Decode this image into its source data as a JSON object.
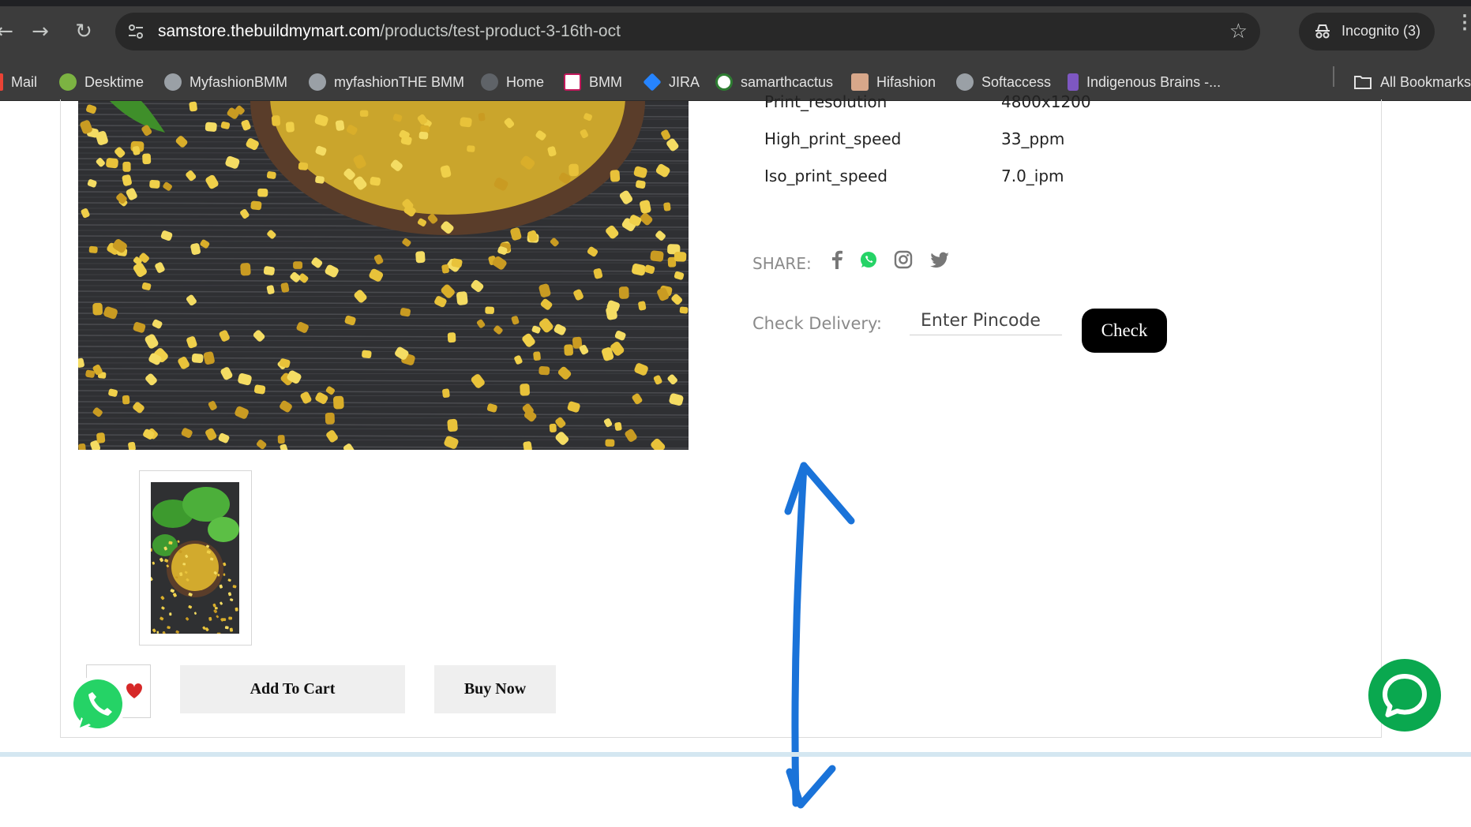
{
  "browser": {
    "url_host": "samstore.thebuildmymart.com",
    "url_path": "/products/test-product-3-16th-oct",
    "incognito_label": "Incognito (3)",
    "nav_icons": [
      "back-arrow-icon",
      "forward-arrow-icon",
      "reload-icon"
    ],
    "bookmarks": [
      {
        "label": "Mail",
        "color": "#ea4335"
      },
      {
        "label": "Desktime",
        "color": "#7cb342"
      },
      {
        "label": "MyfashionBMM",
        "color": "#9aa0a6"
      },
      {
        "label": "myfashionTHE BMM",
        "color": "#9aa0a6"
      },
      {
        "label": "Home",
        "color": "#5f6368"
      },
      {
        "label": "BMM",
        "color": "#c2185b"
      },
      {
        "label": "JIRA",
        "color": "#2684ff"
      },
      {
        "label": "samarthcactus",
        "color": "#2e7d32"
      },
      {
        "label": "Hifashion",
        "color": "#d7a78a"
      },
      {
        "label": "Softaccess",
        "color": "#9aa0a6"
      },
      {
        "label": "Indigenous Brains -...",
        "color": "#7e57c2"
      }
    ],
    "all_bookmarks_label": "All Bookmarks"
  },
  "product": {
    "specs": [
      {
        "key": "Print_resolution",
        "value": "4800x1200"
      },
      {
        "key": "High_print_speed",
        "value": "33_ppm"
      },
      {
        "key": "Iso_print_speed",
        "value": "7.0_ipm"
      }
    ],
    "share_label": "SHARE:",
    "share_icons": [
      "facebook-icon",
      "whatsapp-icon",
      "instagram-icon",
      "twitter-icon"
    ],
    "delivery_label": "Check Delivery:",
    "pincode_placeholder": "Enter Pincode",
    "check_label": "Check",
    "add_to_cart_label": "Add To Cart",
    "buy_now_label": "Buy Now"
  },
  "colors": {
    "chrome_bg": "#3c3c3c",
    "omnibox_bg": "#282828",
    "accent_green": "#0aa84f",
    "annotation_blue": "#1a73d9",
    "check_button": "#000000"
  }
}
